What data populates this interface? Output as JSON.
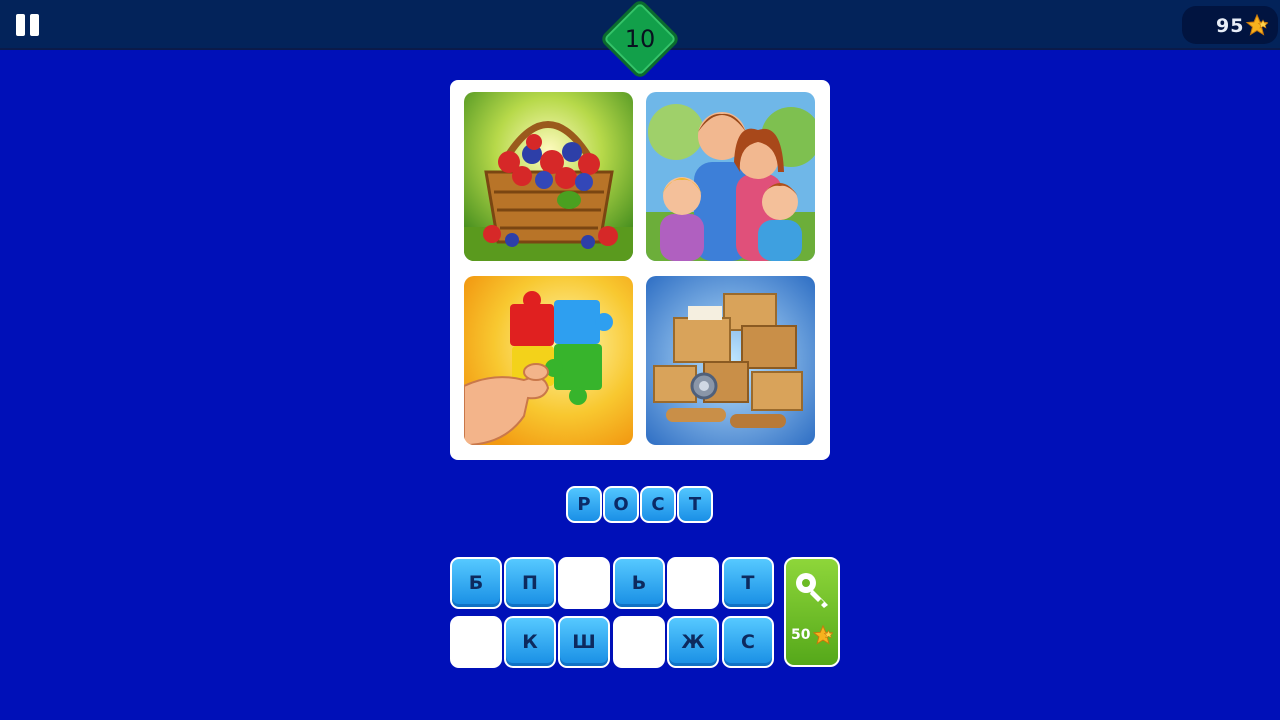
{
  "header": {
    "level": "10",
    "coins": "95",
    "coin_icon": "star-coins-icon",
    "pause_icon": "pause-icon"
  },
  "pictures": [
    {
      "name": "berry-basket-picture"
    },
    {
      "name": "family-picture"
    },
    {
      "name": "puzzle-picture"
    },
    {
      "name": "boxes-picture"
    }
  ],
  "answer": {
    "letters": [
      "Р",
      "О",
      "С",
      "Т"
    ]
  },
  "keyboard": {
    "rows": [
      [
        "Б",
        "П",
        "",
        "Ь",
        "",
        "Т"
      ],
      [
        "",
        "К",
        "Ш",
        "",
        "Ж",
        "С"
      ]
    ]
  },
  "hint": {
    "cost": "50",
    "icon": "key-icon"
  },
  "colors": {
    "background": "#0010b8",
    "topbar": "#03235a",
    "level_badge": "#12a04a",
    "letter_tile": "#2ba6f2",
    "hint_button": "#72c02a",
    "star": "#f7b21d"
  }
}
